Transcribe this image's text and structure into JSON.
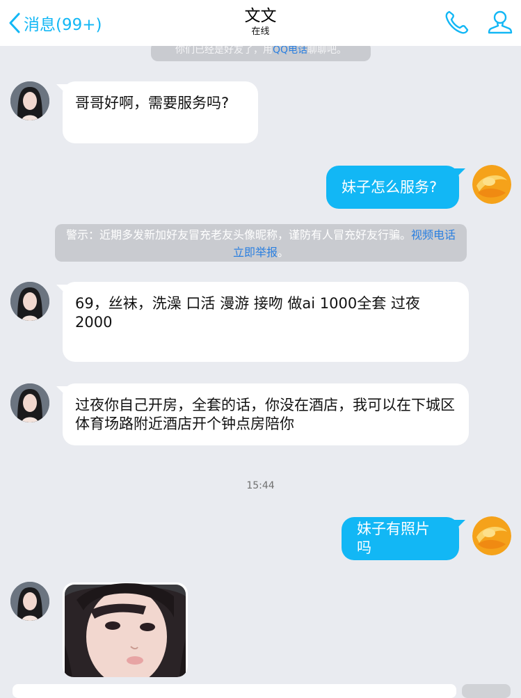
{
  "header": {
    "back_label": "消息(99+)",
    "title": "文文",
    "status": "在线",
    "accent": "#12b7f5"
  },
  "notice_top": {
    "before": "你们已经是好友了，用",
    "link": "QQ电话",
    "after": "聊聊吧。"
  },
  "messages": [
    {
      "side": "left",
      "text": "哥哥好啊，需要服务吗?"
    },
    {
      "side": "right",
      "text": "妹子怎么服务?"
    },
    {
      "side": "left",
      "text": "69，丝袜，洗澡 口活 漫游 接吻  做ai 1000全套 过夜2000"
    },
    {
      "side": "left",
      "text": "过夜你自己开房，全套的话，你没在酒店，我可以在下城区体育场路附近酒店开个钟点房陪你"
    },
    {
      "side": "right",
      "text": "妹子有照片吗"
    }
  ],
  "warning": {
    "text": "警示：近期多发新加好友冒充老友头像昵称，谨防有人冒充好友行骗。",
    "link1": "视频电话",
    "link2": "立即举报",
    "end": "。"
  },
  "timestamp": "15:44",
  "icons": {
    "back": "chevron-left-icon",
    "call": "phone-icon",
    "profile": "person-icon"
  }
}
